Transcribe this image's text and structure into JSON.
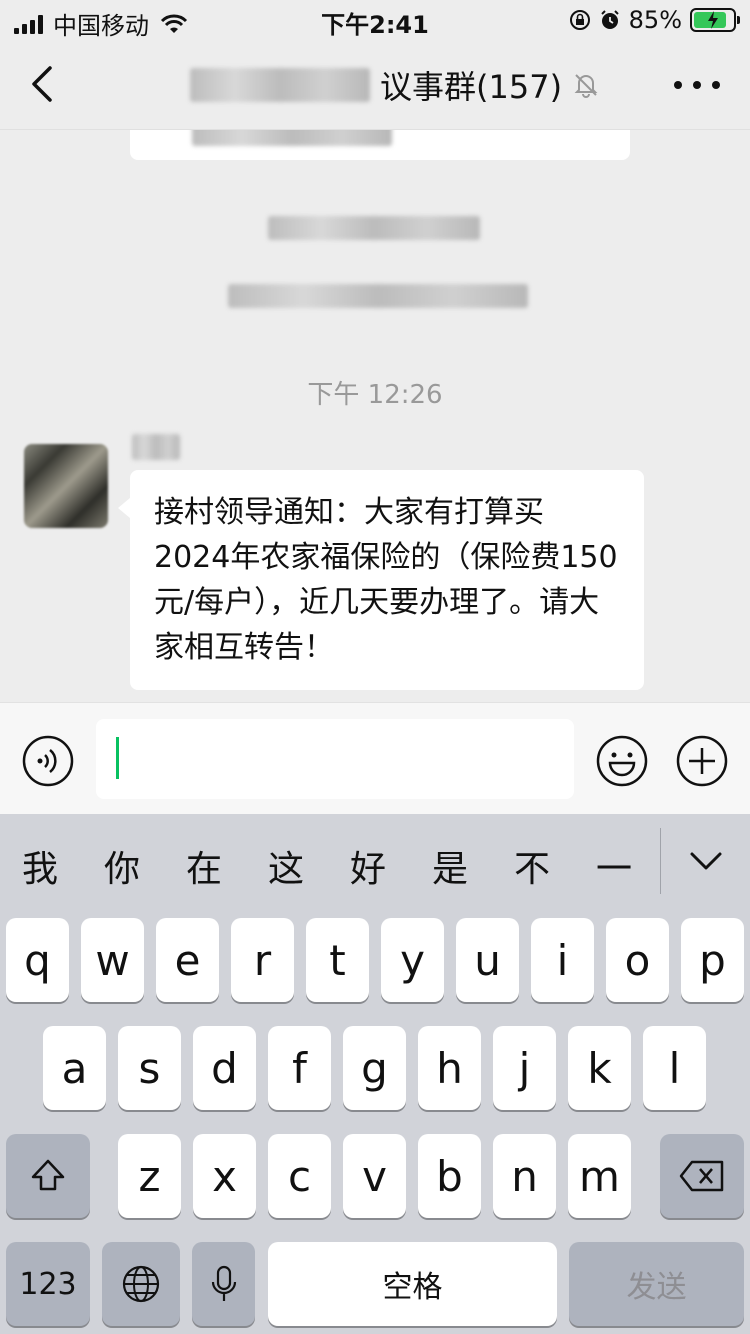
{
  "status_bar": {
    "carrier": "中国移动",
    "time": "下午2:41",
    "battery_percent": "85%",
    "battery_level": 0.85
  },
  "nav": {
    "title": "议事群(157)",
    "muted": true
  },
  "chat": {
    "time_divider": "下午 12:26",
    "message": "接村领导通知：大家有打算买2024年农家福保险的（保险费150元/每户），近几天要办理了。请大家相互转告！"
  },
  "input": {
    "value": ""
  },
  "keyboard": {
    "candidates": [
      "我",
      "你",
      "在",
      "这",
      "好",
      "是",
      "不",
      "一"
    ],
    "row1": [
      "q",
      "w",
      "e",
      "r",
      "t",
      "y",
      "u",
      "i",
      "o",
      "p"
    ],
    "row2": [
      "a",
      "s",
      "d",
      "f",
      "g",
      "h",
      "j",
      "k",
      "l"
    ],
    "row3": [
      "z",
      "x",
      "c",
      "v",
      "b",
      "n",
      "m"
    ],
    "numbers_key": "123",
    "space_key": "空格",
    "send_key": "发送"
  },
  "colors": {
    "accent": "#07c160",
    "background": "#ededed",
    "keyboard_bg": "#d1d3d9"
  },
  "icons": [
    "signal-icon",
    "wifi-icon",
    "rotation-lock-icon",
    "alarm-icon",
    "battery-icon",
    "back-icon",
    "mute-icon",
    "more-icon",
    "voice-icon",
    "emoji-icon",
    "plus-icon",
    "chevron-down-icon",
    "shift-icon",
    "delete-icon",
    "globe-icon",
    "microphone-icon"
  ]
}
